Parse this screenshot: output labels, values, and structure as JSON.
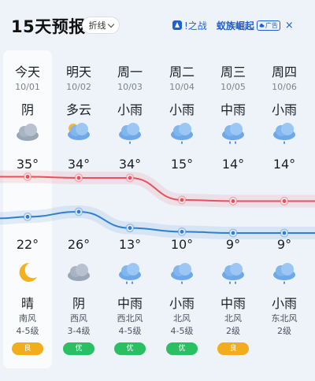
{
  "header": {
    "title": "15天预报",
    "mode_label": "折线"
  },
  "ad": {
    "text1": "!之战",
    "text2": "蚁族崛起",
    "badge": "广告",
    "close": "×"
  },
  "days": [
    {
      "day": "今天",
      "date": "10/01",
      "weather_day": "阴",
      "icon_day": "cloudy-icon",
      "hi": "35°",
      "hi_val": 35,
      "lo": "22°",
      "lo_val": 22,
      "icon_night": "moon-icon",
      "weather_night": "晴",
      "wind": "南风",
      "wind_level": "4-5级",
      "aqi": "良",
      "aqi_level": "fair"
    },
    {
      "day": "明天",
      "date": "10/02",
      "weather_day": "多云",
      "icon_day": "partly-cloudy-icon",
      "hi": "34°",
      "hi_val": 34,
      "lo": "26°",
      "lo_val": 26,
      "icon_night": "cloudy-icon",
      "weather_night": "阴",
      "wind": "西风",
      "wind_level": "3-4级",
      "aqi": "优",
      "aqi_level": "good"
    },
    {
      "day": "周一",
      "date": "10/03",
      "weather_day": "小雨",
      "icon_day": "light-rain-icon",
      "hi": "34°",
      "hi_val": 34,
      "lo": "13°",
      "lo_val": 13,
      "icon_night": "moderate-rain-icon",
      "weather_night": "中雨",
      "wind": "西北风",
      "wind_level": "4-5级",
      "aqi": "优",
      "aqi_level": "good"
    },
    {
      "day": "周二",
      "date": "10/04",
      "weather_day": "小雨",
      "icon_day": "light-rain-icon",
      "hi": "15°",
      "hi_val": 15,
      "lo": "10°",
      "lo_val": 10,
      "icon_night": "light-rain-icon",
      "weather_night": "小雨",
      "wind": "北风",
      "wind_level": "4-5级",
      "aqi": "优",
      "aqi_level": "good"
    },
    {
      "day": "周三",
      "date": "10/05",
      "weather_day": "中雨",
      "icon_day": "moderate-rain-icon",
      "hi": "14°",
      "hi_val": 14,
      "lo": "9°",
      "lo_val": 9,
      "icon_night": "moderate-rain-icon",
      "weather_night": "中雨",
      "wind": "北风",
      "wind_level": "2级",
      "aqi": "良",
      "aqi_level": "fair"
    },
    {
      "day": "周四",
      "date": "10/06",
      "weather_day": "小雨",
      "icon_day": "light-rain-icon",
      "hi": "14°",
      "hi_val": 14,
      "lo": "9°",
      "lo_val": 9,
      "icon_night": "light-rain-icon",
      "weather_night": "小雨",
      "wind": "东北风",
      "wind_level": "2级",
      "aqi": "",
      "aqi_level": "none"
    }
  ],
  "colors": {
    "high_line": "#e8505b",
    "low_line": "#2f7fd1",
    "aqi_good": "#2bbf63",
    "aqi_fair": "#f2ad1c"
  }
}
